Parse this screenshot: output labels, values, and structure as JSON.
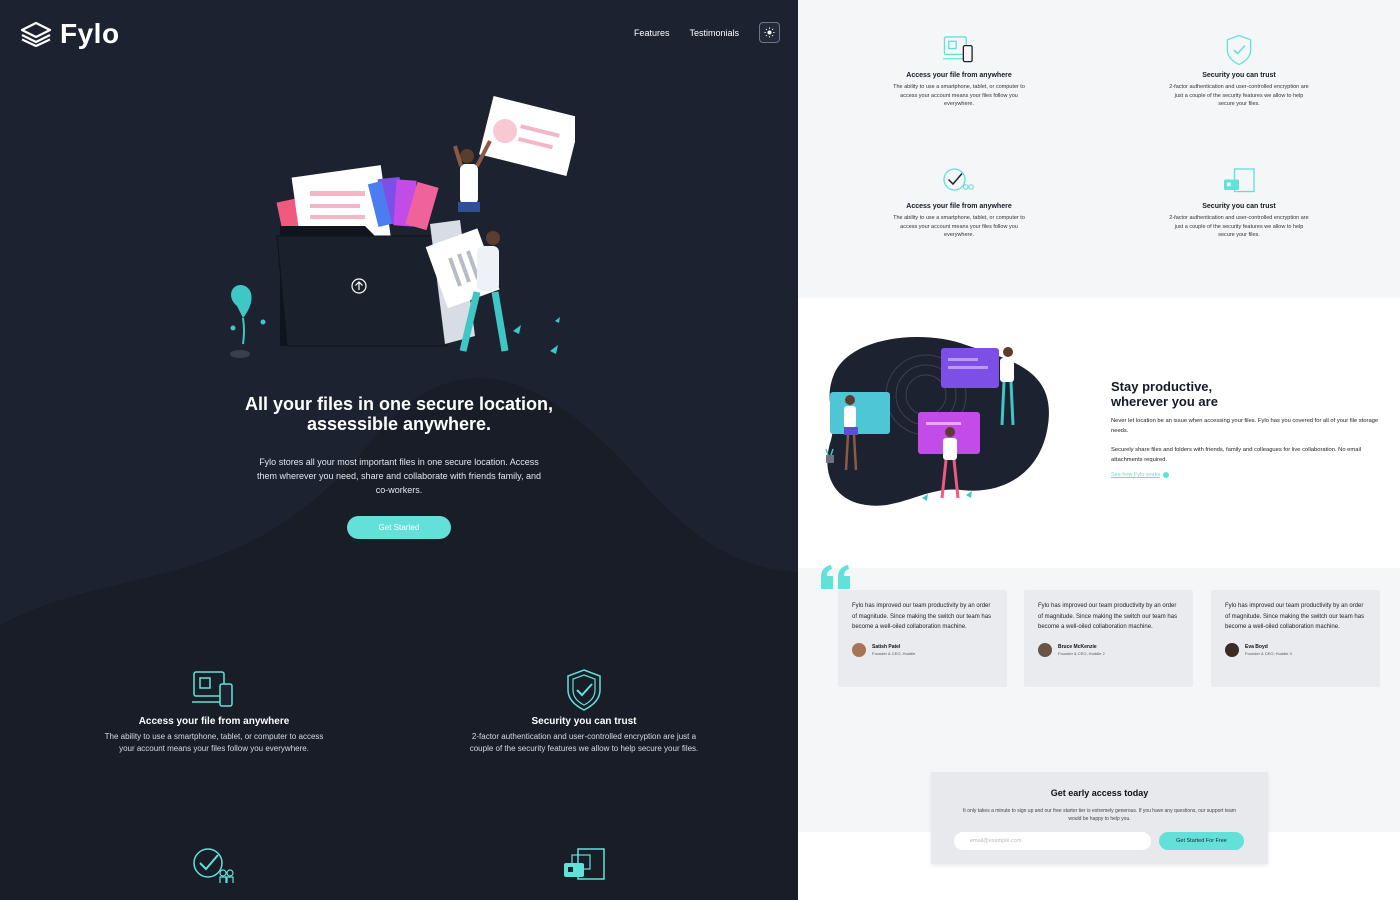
{
  "brand": {
    "name": "Fylo",
    "accent": "#63e1d9",
    "dark_bg": "#1c2230",
    "light_bg": "#f5f6f8"
  },
  "nav": {
    "items": [
      {
        "label": "Features"
      },
      {
        "label": "Testimonials"
      }
    ],
    "theme_toggle_icon": "sun-icon"
  },
  "hero": {
    "title_line1": "All your files in one secure location,",
    "title_line2": "assessible anywhere.",
    "text": "Fylo stores all your most important files in one secure location. Access them wherever you need, share and collaborate with friends family, and co-workers.",
    "cta_label": "Get Started",
    "upload_icon": "upload-arrow-icon"
  },
  "features": [
    {
      "icon": "devices-icon",
      "title": "Access your file from anywhere",
      "description": "The ability to use a smartphone, tablet, or computer to access your account means your files follow you everywhere."
    },
    {
      "icon": "shield-check-icon",
      "title": "Security you can trust",
      "description": "2-factor authentication and user-controlled encryption are just a couple of the security features we allow to help secure your files."
    },
    {
      "icon": "collaboration-icon",
      "title": "Access your file from anywhere",
      "description": "The ability to use a smartphone, tablet, or computer to access your account means your files follow you everywhere."
    },
    {
      "icon": "file-store-icon",
      "title": "Security you can trust",
      "description": "2-factor authentication and user-controlled encryption are just a couple of the security features we allow to help secure your files."
    }
  ],
  "productive": {
    "title_line1": "Stay productive,",
    "title_line2": "wherever you are",
    "p1": "Never let location be an issue when accessing your files. Fylo has you covered for all of your file storage needs.",
    "p2": "Securely share files and folders with friends, family and colleagues for live collaboration. No email attachments required.",
    "link": "See how Fylo works"
  },
  "testimonials": [
    {
      "quote": "Fylo has improved our team productivity by an order of magnitude. Since making the switch our team has become a well-oiled collaboration machine.",
      "name": "Satish Patel",
      "role": "Founder & CEO, Huddle"
    },
    {
      "quote": "Fylo has improved our team productivity by an order of magnitude. Since making the switch our team has become a well-oiled collaboration machine.",
      "name": "Bruce McKenzie",
      "role": "Founder & CEO, Huddle 2"
    },
    {
      "quote": "Fylo has improved our team productivity by an order of magnitude. Since making the switch our team has become a well-oiled collaboration machine.",
      "name": "Eva Boyd",
      "role": "Founder & CEO, Huddle 3"
    }
  ],
  "access": {
    "title": "Get early access today",
    "text": "It only takes a minute to sign up and our free starter tier is extremely generous. If you have any questions, our support team would be happy to help you.",
    "email_placeholder": "email@example.com",
    "button_label": "Get Started For Free"
  }
}
